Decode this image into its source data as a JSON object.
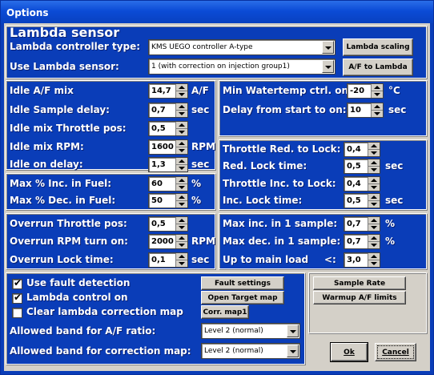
{
  "window": {
    "title": "Options"
  },
  "header": {
    "title": "Lambda sensor"
  },
  "controller": {
    "label": "Lambda controller type:",
    "value": "KMS UEGO controller A-type"
  },
  "use_sensor": {
    "label": "Use Lambda sensor:",
    "value": "1 (with correction on injection group1)"
  },
  "buttons": {
    "lambda_scaling": "Lambda scaling",
    "af_to_lambda": "A/F to Lambda",
    "fault_settings": "Fault settings",
    "open_target_map": "Open Target map",
    "corr_map1": "Corr. map1",
    "sample_rate": "Sample Rate",
    "warmup_limits": "Warmup A/F limits",
    "ok": "Ok",
    "cancel": "Cancel"
  },
  "idle": {
    "af_mix": {
      "label": "Idle A/F mix",
      "value": "14,7",
      "unit": "A/F"
    },
    "sample_delay": {
      "label": "Idle Sample delay:",
      "value": "0,7",
      "unit": "sec"
    },
    "throttle_pos": {
      "label": "Idle mix Throttle pos:",
      "value": "0,5"
    },
    "rpm": {
      "label": "Idle mix RPM:",
      "value": "1600",
      "unit": "RPM"
    },
    "on_delay": {
      "label": "Idle on delay:",
      "value": "1,3",
      "unit": "sec"
    }
  },
  "watertemp": {
    "min": {
      "label": "Min Watertemp ctrl. on:",
      "value": "-20",
      "unit": "°C"
    },
    "delay": {
      "label": "Delay from start to on:",
      "value": "10",
      "unit": "sec"
    }
  },
  "fuel": {
    "max_inc": {
      "label": "Max % Inc. in Fuel:",
      "value": "60",
      "unit": "%"
    },
    "max_dec": {
      "label": "Max % Dec. in Fuel:",
      "value": "50",
      "unit": "%"
    }
  },
  "lock": {
    "throttle_red": {
      "label": "Throttle Red. to Lock:",
      "value": "0,4"
    },
    "red_time": {
      "label": "Red. Lock time:",
      "value": "0,5",
      "unit": "sec"
    },
    "throttle_inc": {
      "label": "Throttle Inc. to Lock:",
      "value": "0,4"
    },
    "inc_time": {
      "label": "Inc. Lock time:",
      "value": "0,5",
      "unit": "sec"
    }
  },
  "overrun": {
    "throttle_pos": {
      "label": "Overrun Throttle pos:",
      "value": "0,5"
    },
    "rpm": {
      "label": "Overrun RPM turn on:",
      "value": "2000",
      "unit": "RPM"
    },
    "lock_time": {
      "label": "Overrun Lock time:",
      "value": "0,1",
      "unit": "sec"
    }
  },
  "sample": {
    "max_inc": {
      "label": "Max inc. in 1 sample:",
      "value": "0,7",
      "unit": "%"
    },
    "max_dec": {
      "label": "Max dec. in 1 sample:",
      "value": "0,7",
      "unit": "%"
    },
    "main_load": {
      "label": "Up to main load",
      "op": "<:",
      "value": "3,0"
    }
  },
  "options": {
    "fault_detection": {
      "label": "Use fault detection",
      "checked": "✔"
    },
    "lambda_control": {
      "label": "Lambda control on",
      "checked": "✔"
    },
    "clear_map": {
      "label": "Clear lambda correction map"
    }
  },
  "bands": {
    "af_ratio": {
      "label": "Allowed band for A/F ratio:",
      "value": "Level 2 (normal)"
    },
    "corr_map": {
      "label": "Allowed band for correction map:",
      "value": "Level 2 (normal)"
    }
  }
}
